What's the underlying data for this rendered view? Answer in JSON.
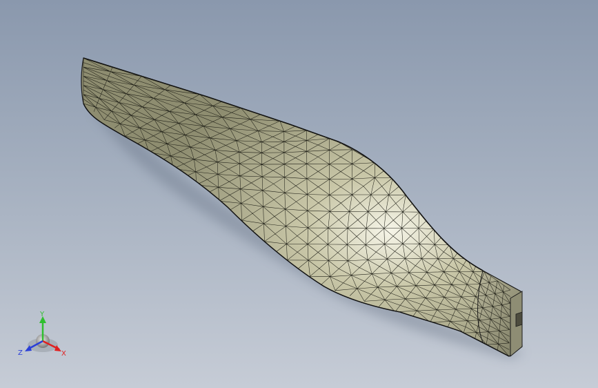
{
  "viewport": {
    "background_top": "#8a98ad",
    "background_bottom": "#c6ccd6"
  },
  "model": {
    "icon": "propeller-blade-mesh",
    "surface_color": "#c9c7a8",
    "highlight_color": "#f4f3e6",
    "shadow_color": "#6f6e58",
    "edge_color": "#1a1a1a"
  },
  "triad": {
    "y_label": "Y",
    "z_label": "Z",
    "x_label": "X",
    "y_color": "#2fbf2f",
    "z_color": "#2a3fd8",
    "x_color": "#e02020"
  }
}
